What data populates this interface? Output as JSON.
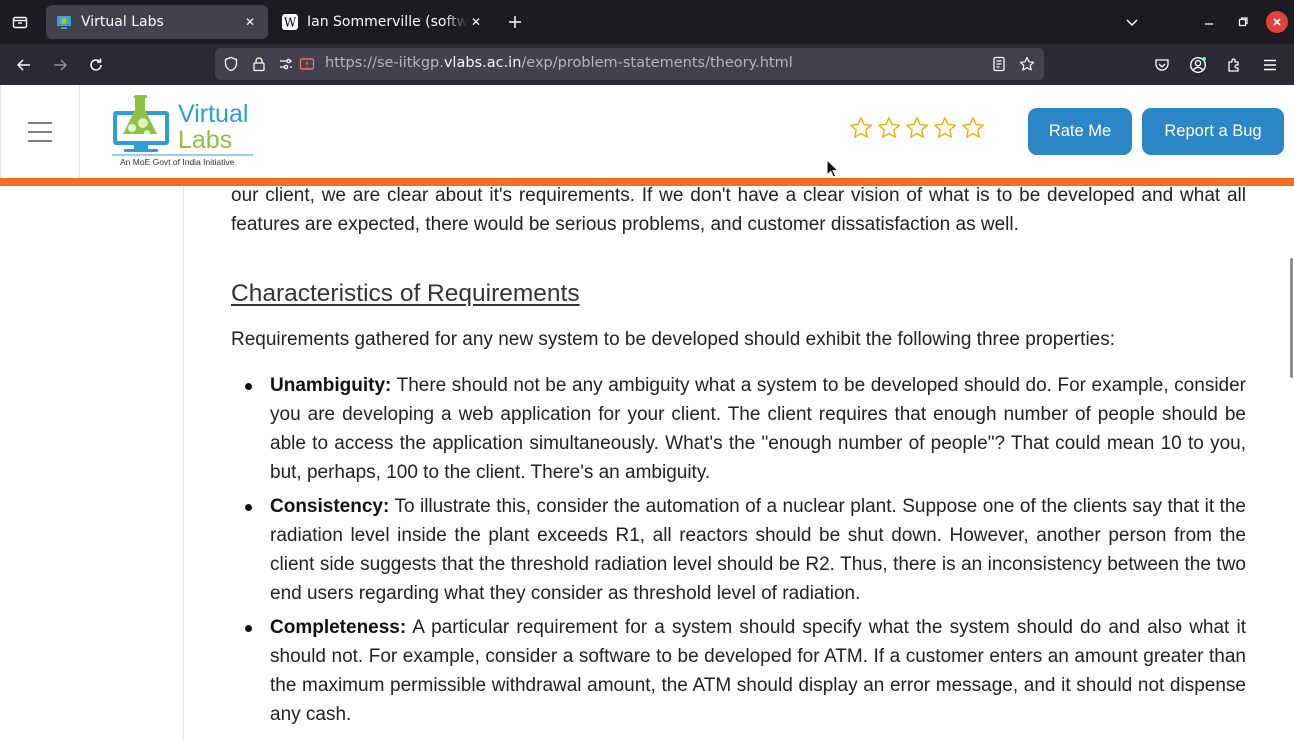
{
  "browser": {
    "tabs": [
      {
        "title": "Virtual Labs",
        "active": true,
        "icon": "virtual-labs-favicon"
      },
      {
        "title": "Ian Sommerville (software",
        "active": false,
        "icon": "wikipedia-favicon"
      }
    ],
    "url": {
      "prefix": "https://se-iitkgp.",
      "host": "vlabs.ac.in",
      "path": "/exp/problem-statements/theory.html"
    }
  },
  "header": {
    "logo_text_top": "Virtual",
    "logo_text_bottom": "Labs",
    "logo_tagline": "An MoE Govt of India Initiative",
    "rating_stars": 5,
    "rating_value": 0,
    "rate_button": "Rate Me",
    "bug_button": "Report a Bug",
    "accent_color": "#2b86c5",
    "bar_color": "#f26e20"
  },
  "content": {
    "intro_tail": "our client, we are clear about it's requirements. If we don't have a clear vision of what is to be developed and what all features are expected, there would be serious problems, and customer dissatisfaction as well.",
    "heading": "Characteristics of Requirements",
    "lead": "Requirements gathered for any new system to be developed should exhibit the following three properties:",
    "properties": [
      {
        "term": "Unambiguity:",
        "text": " There should not be any ambiguity what a system to be developed should do. For example, consider you are developing a web application for your client. The client requires that enough number of people should be able to access the application simultaneously. What's the \"enough number of people\"? That could mean 10 to you, but, perhaps, 100 to the client. There's an ambiguity."
      },
      {
        "term": "Consistency:",
        "text": " To illustrate this, consider the automation of a nuclear plant. Suppose one of the clients say that it the radiation level inside the plant exceeds R1, all reactors should be shut down. However, another person from the client side suggests that the threshold radiation level should be R2. Thus, there is an inconsistency between the two end users regarding what they consider as threshold level of radiation."
      },
      {
        "term": "Completeness:",
        "text": " A particular requirement for a system should specify what the system should do and also what it should not. For example, consider a software to be developed for ATM. If a customer enters an amount greater than the maximum permissible withdrawal amount, the ATM should display an error message, and it should not dispense any cash."
      }
    ]
  }
}
